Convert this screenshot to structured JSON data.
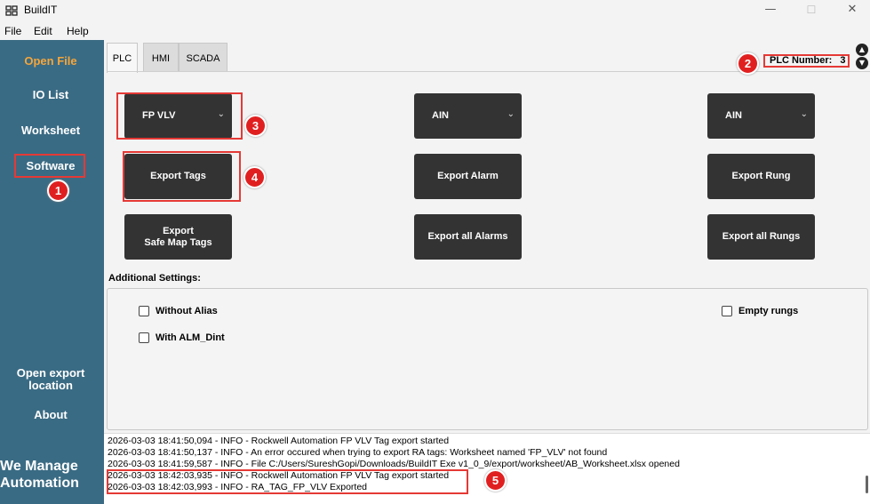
{
  "window": {
    "title": "BuildIT",
    "minimize": "—",
    "maximize": "☐",
    "close": "✕"
  },
  "menu": [
    "File",
    "Edit",
    "Help"
  ],
  "sidebar": {
    "items": [
      {
        "label": "Open File"
      },
      {
        "label": "IO List"
      },
      {
        "label": "Worksheet"
      },
      {
        "label": "Software"
      },
      {
        "label": "Open export location"
      },
      {
        "label": "About"
      }
    ],
    "brand": "We Manage Automation"
  },
  "tabs": [
    "PLC",
    "HMI",
    "SCADA"
  ],
  "plc_number": {
    "label": "PLC Number:",
    "value": "3"
  },
  "dropdowns": [
    {
      "value": "FP VLV"
    },
    {
      "value": "AIN"
    },
    {
      "value": "AIN"
    }
  ],
  "buttons": {
    "export_tags": "Export Tags",
    "export_alarm": "Export Alarm",
    "export_rung": "Export Rung",
    "export_safe_map_tags_line1": "Export",
    "export_safe_map_tags_line2": "Safe Map Tags",
    "export_all_alarms": "Export all Alarms",
    "export_all_rungs": "Export all Rungs"
  },
  "settings": {
    "title": "Additional Settings:",
    "options": [
      {
        "label": "Without Alias",
        "checked": false
      },
      {
        "label": "With ALM_Dint",
        "checked": false
      },
      {
        "label": "Empty rungs",
        "checked": false
      }
    ]
  },
  "log": [
    "2026-03-03 18:41:50,094 - INFO - Rockwell Automation FP VLV Tag export started",
    "2026-03-03 18:41:50,137 - INFO - An error occured when trying to export RA tags: Worksheet named 'FP_VLV' not found",
    "2026-03-03 18:41:59,587 - INFO - File C:/Users/SureshGopi/Downloads/BuildIT Exe v1_0_9/export/worksheet/AB_Worksheet.xlsx opened",
    "2026-03-03 18:42:03,935 - INFO - Rockwell Automation FP VLV Tag export started",
    "2026-03-03 18:42:03,993 - INFO - RA_TAG_FP_VLV Exported"
  ],
  "callouts": [
    "1",
    "2",
    "3",
    "4",
    "5"
  ],
  "colors": {
    "sidebar": "#3a6b84",
    "accent": "#f5a63b",
    "button": "#333333",
    "highlight": "#e53935"
  }
}
